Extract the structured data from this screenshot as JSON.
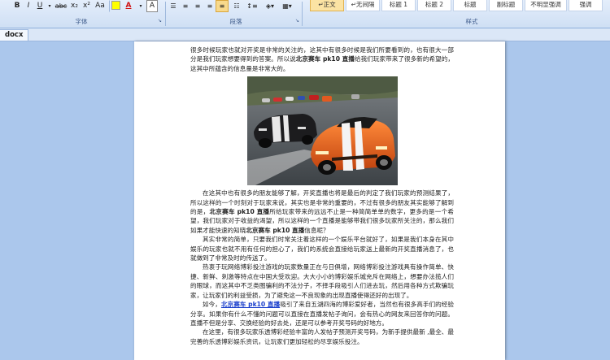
{
  "ribbon": {
    "groups": {
      "font": "字体",
      "paragraph": "段落",
      "styles": "样式"
    },
    "font_buttons": [
      "B",
      "I",
      "U",
      "abc",
      "x₂",
      "x²",
      "Aa"
    ],
    "font_color_label": "A",
    "char_border_label": "A",
    "styles": [
      {
        "label": "↵正文",
        "active": true
      },
      {
        "label": "↵无间隔",
        "active": false
      },
      {
        "label": "标题 1",
        "active": false
      },
      {
        "label": "标题 2",
        "active": false
      },
      {
        "label": "标题",
        "active": false
      },
      {
        "label": "副标题",
        "active": false
      },
      {
        "label": "不明显强调",
        "active": false
      },
      {
        "label": "强调",
        "active": false
      }
    ]
  },
  "tab": {
    "label": "docx"
  },
  "document": {
    "p1": "很多时候玩家也就对开奖是非常的关注的，这其中有很多时候是我们所要看到的，也有很大一部分是我们玩家想要得到的答案。所以说",
    "p1_bold": "北京赛车 pk10 直播",
    "p1_end": "给我们玩家带来了很多新的希望的，这其中所蕴含的信息量是非常大的。",
    "p2a": "在这其中也有很多的朋友能够了解，开奖直播也将是最后的判定了我们玩家的预测结果了，所以这样的一个时刻对于玩家来说，其实也是非常的重要的，不过有很多的朋友其实能够了解到的是，",
    "p2_bold1": "北京赛车 pk10 直播",
    "p2b": "所给玩家带来的远远不止是一种简简单单的数字，更多的是一个希望，我们玩家对于收益的渴望，所以这样的一个直播是能够带我们很多玩家所关注的，那么我们如果才能快速的知晓",
    "p2_bold2": "北京赛车 pk10 直播",
    "p2c": "信息呢？",
    "p3": "其实非常的简单，只要我们时常关注着这样的一个娱乐平台就好了，如果是我们本身在其中娱乐的玩家也就不用有任何的担心了，我们的系统会直接给玩家送上最新的开奖直播消息了，也就做到了非常及时的传送了。",
    "p4": "热衷于玩网络博彩投注游戏的玩家数量正在与日俱增，网络博彩投注游戏具有操作简单、快捷、新鲜、刺激等特点在中国大受欢迎。大大小小的博彩娱乐城充斥在网络上，想要办法揽人们的眼球，而这其中不乏类图骗利的不法分子，不择手段吸引人们进去玩，然后用各种方式欺骗玩家，让玩家们的利益受损，为了避免这一不良现象的出现直播使得还好的出现了。",
    "p5a": "如今，",
    "p5_link": "北京赛车 pk10 直播",
    "p5b": "吸引了来自五湖四海的博彩爱好者，当然也有很多高手们的经验分享。如果你有什么不懂的问题可以直接在直播发帖子询问，会有热心的网友来回答你的问题。直播不但是分享、交换经验的好去处，还是可以参考开奖号码的好地方。",
    "p6": "在这里，有很多玩家乐透博彩经验丰富的人发帖子预测开奖号码，为新手提供最新 ,最全、最完善的乐透博彩娱乐资讯，让玩家们更加轻松的尽享娱乐投注。"
  },
  "colors": {
    "accent": "#1a3fcc",
    "ribbon": "#cfdff4",
    "workspace": "#abc7ec"
  }
}
